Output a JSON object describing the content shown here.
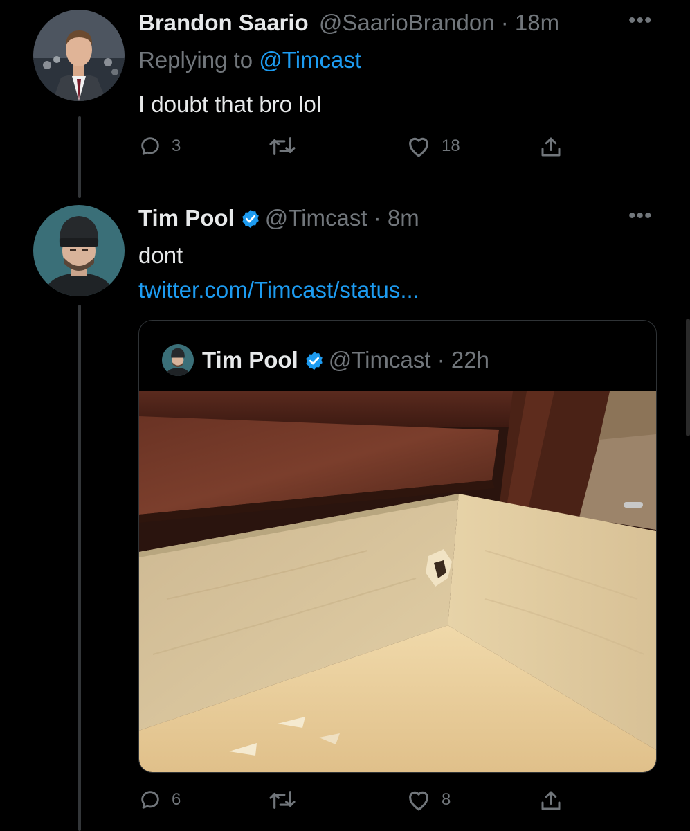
{
  "reply_tweet": {
    "author_name": "Brandon Saario",
    "handle": "@SaarioBrandon",
    "separator": "·",
    "time": "18m",
    "replying_prefix": "Replying to",
    "replying_to": "@Timcast",
    "text": "I doubt that bro lol",
    "reply_count": "3",
    "retweet_count": "",
    "like_count": "18",
    "more_icon": "more-horizontal-icon"
  },
  "main_tweet": {
    "author_name": "Tim Pool",
    "verified": true,
    "handle": "@Timcast",
    "separator": "·",
    "time": "8m",
    "text": "dont",
    "link": "twitter.com/Timcast/status...",
    "reply_count": "6",
    "retweet_count": "",
    "like_count": "8"
  },
  "quoted_tweet": {
    "author_name": "Tim Pool",
    "verified": true,
    "handle": "@Timcast",
    "separator": "·",
    "time": "22h",
    "image_alt": "Open wooden drawer with a broken hole in its inner panel"
  },
  "colors": {
    "background": "#000000",
    "text": "#e7e9ea",
    "muted": "#71767b",
    "link": "#1d9bf0",
    "verified": "#1d9bf0"
  }
}
